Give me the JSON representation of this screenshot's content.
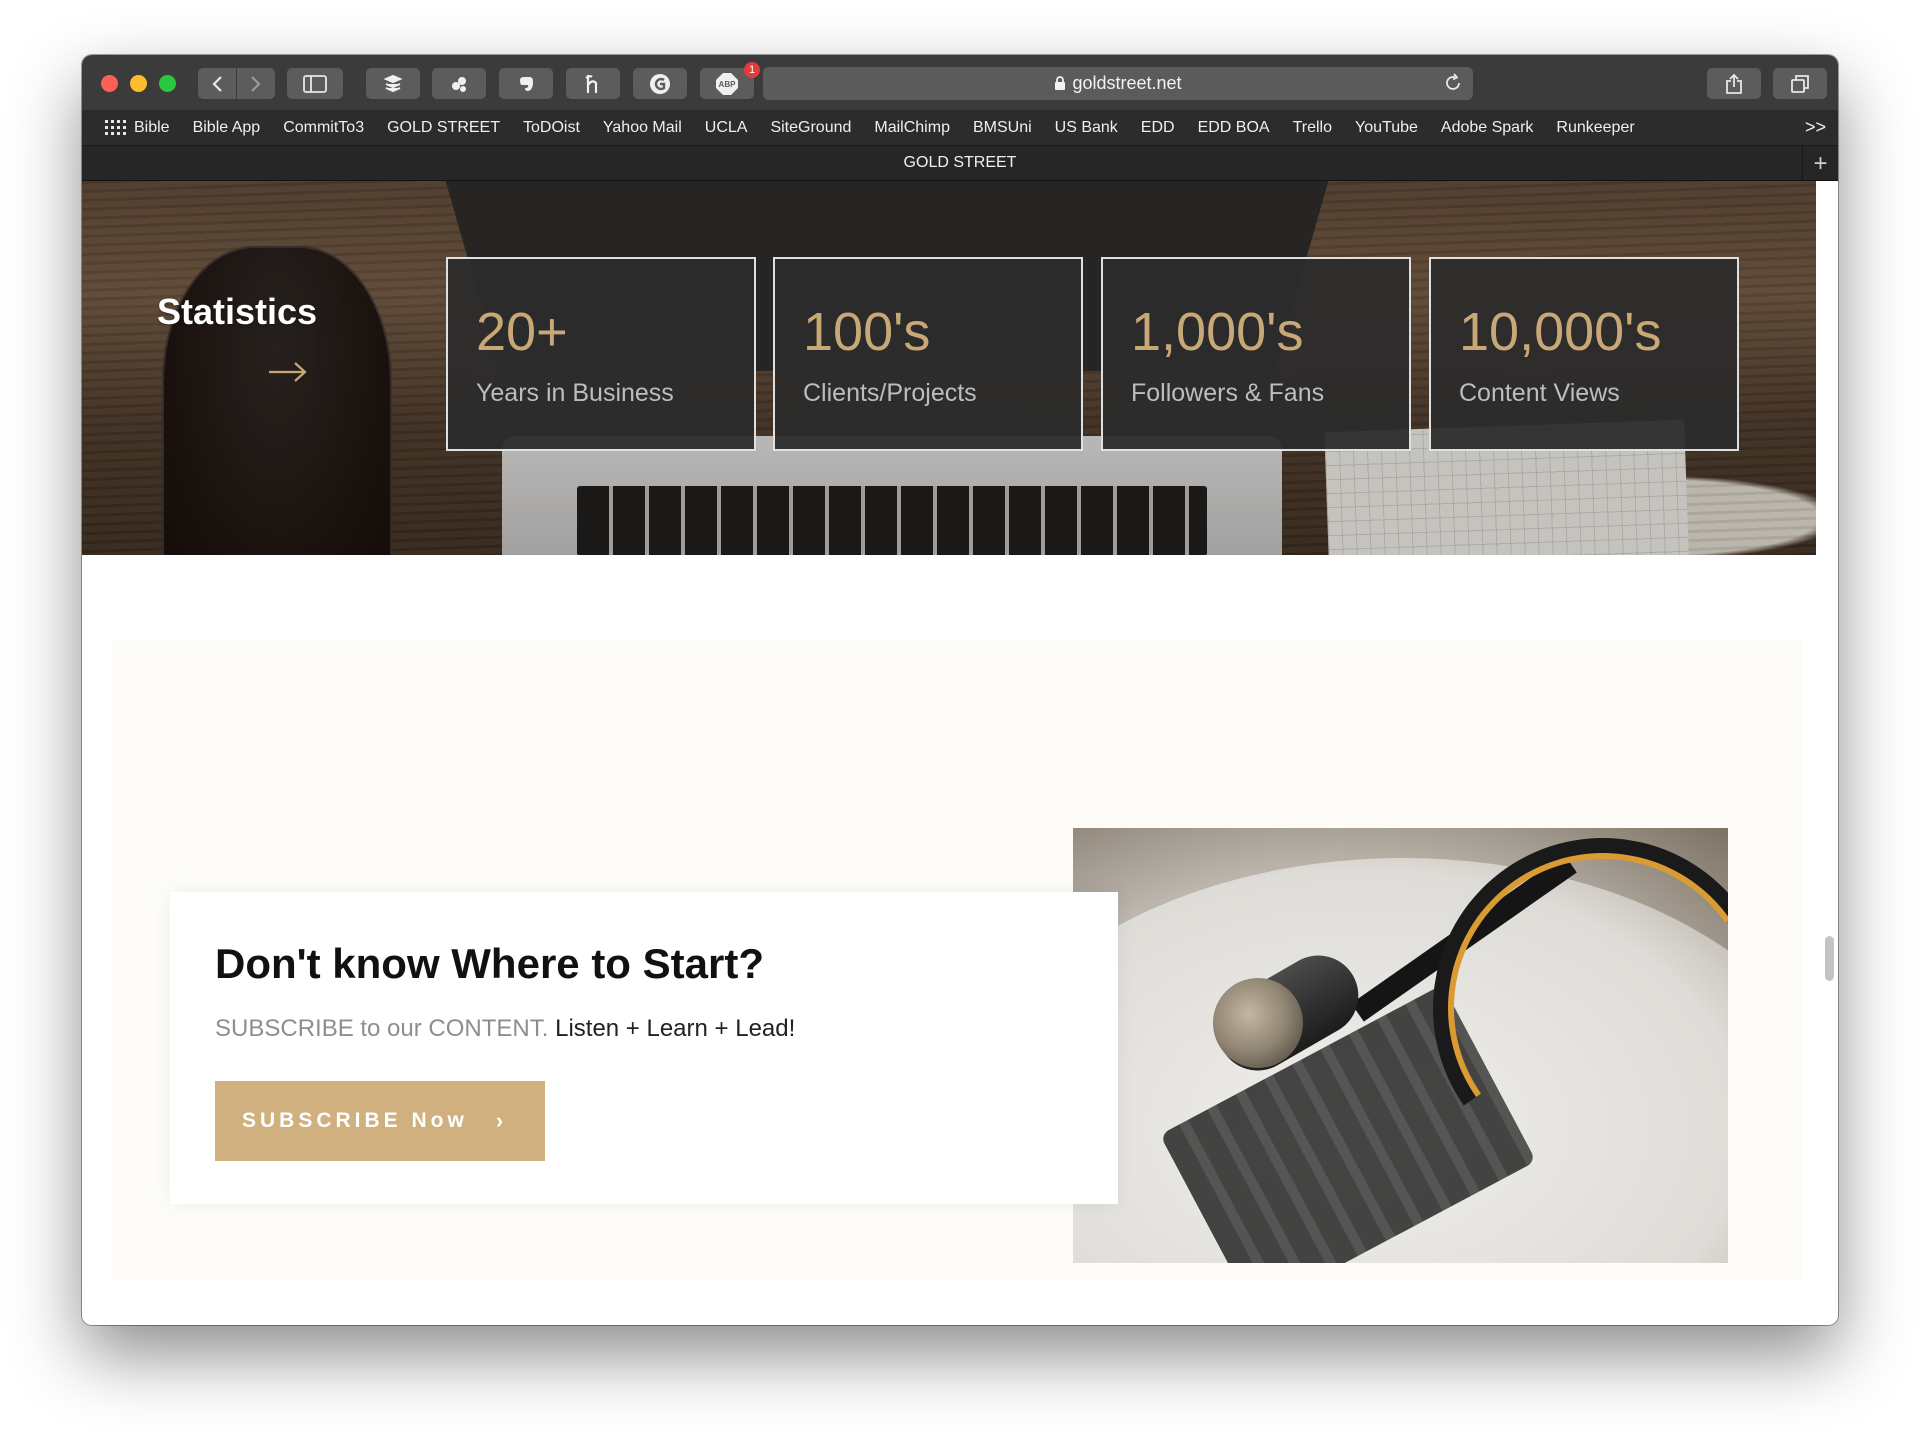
{
  "browser": {
    "address": "goldstreet.net",
    "tab_title": "GOLD STREET",
    "extension_badge": "1",
    "bookmarks": [
      "Bible",
      "Bible App",
      "CommitTo3",
      "GOLD STREET",
      "ToDOist",
      "Yahoo Mail",
      "UCLA",
      "SiteGround",
      "MailChimp",
      "BMSUni",
      "US Bank",
      "EDD",
      "EDD BOA",
      "Trello",
      "YouTube",
      "Adobe Spark",
      "Runkeeper"
    ],
    "bookmarks_more": ">>",
    "new_tab": "+"
  },
  "stats": {
    "title": "Statistics",
    "items": [
      {
        "value": "20+",
        "label": "Years in Business"
      },
      {
        "value": "100's",
        "label": "Clients/Projects"
      },
      {
        "value": "1,000's",
        "label": "Followers & Fans"
      },
      {
        "value": "10,000's",
        "label": "Content Views"
      }
    ]
  },
  "cta": {
    "heading": "Don't know Where to Start?",
    "sub_muted": "SUBSCRIBE to our CONTENT.",
    "sub_dark": "Listen + Learn + Lead!",
    "button_label": "SUBSCRIBE Now",
    "button_chevron": "›"
  },
  "colors": {
    "gold": "#cfb07e",
    "stat_value": "#c9a878",
    "stat_box": "#2c2c2c",
    "toolbar": "#3b3b3b"
  },
  "icons": [
    "back-icon",
    "forward-icon",
    "sidebar-icon",
    "buffer-icon",
    "extension-icon",
    "evernote-icon",
    "honey-icon",
    "grammarly-icon",
    "adblock-icon",
    "lock-icon",
    "reload-icon",
    "share-icon",
    "tabs-overview-icon",
    "apps-grid-icon",
    "arrow-right-icon"
  ]
}
